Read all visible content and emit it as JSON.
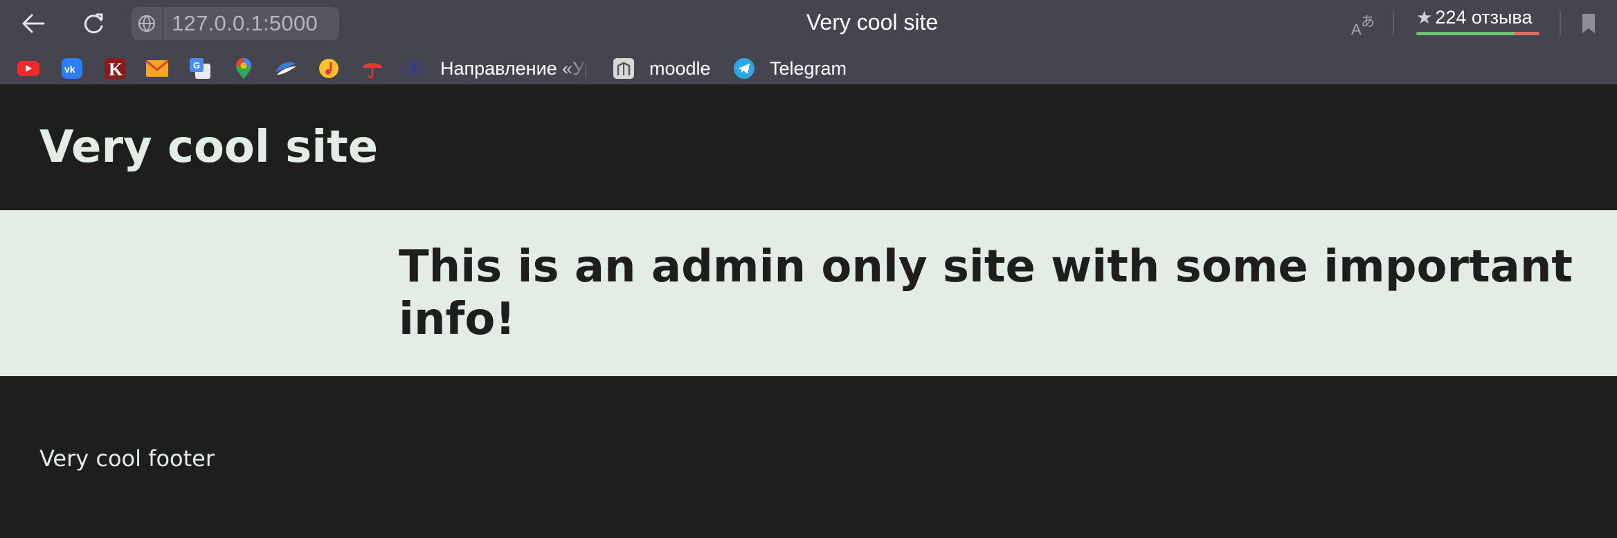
{
  "browser": {
    "url": "127.0.0.1:5000",
    "tab_title": "Very cool site",
    "reviews": {
      "label": "224 отзыва",
      "positive_fraction": 0.8,
      "positive_color": "#6fbf73",
      "negative_color": "#e26b68"
    },
    "bookmarks": [
      {
        "icon": "youtube-icon"
      },
      {
        "icon": "vk-icon"
      },
      {
        "icon": "kinopoisk-icon"
      },
      {
        "icon": "mail-icon"
      },
      {
        "icon": "google-translate-icon"
      },
      {
        "icon": "google-maps-icon"
      },
      {
        "icon": "wave-icon"
      },
      {
        "icon": "music-icon"
      },
      {
        "icon": "umbrella-icon"
      },
      {
        "icon": "university-icon",
        "label": "Направление «Ур"
      },
      {
        "icon": "moodle-icon",
        "label": "moodle"
      },
      {
        "icon": "telegram-icon",
        "label": "Telegram"
      }
    ]
  },
  "site": {
    "title": "Very cool site",
    "banner": "This is an admin only site with some important info!",
    "footer": "Very cool footer",
    "colors": {
      "dark": "#1e1e1e",
      "light": "#e3ede5"
    }
  }
}
